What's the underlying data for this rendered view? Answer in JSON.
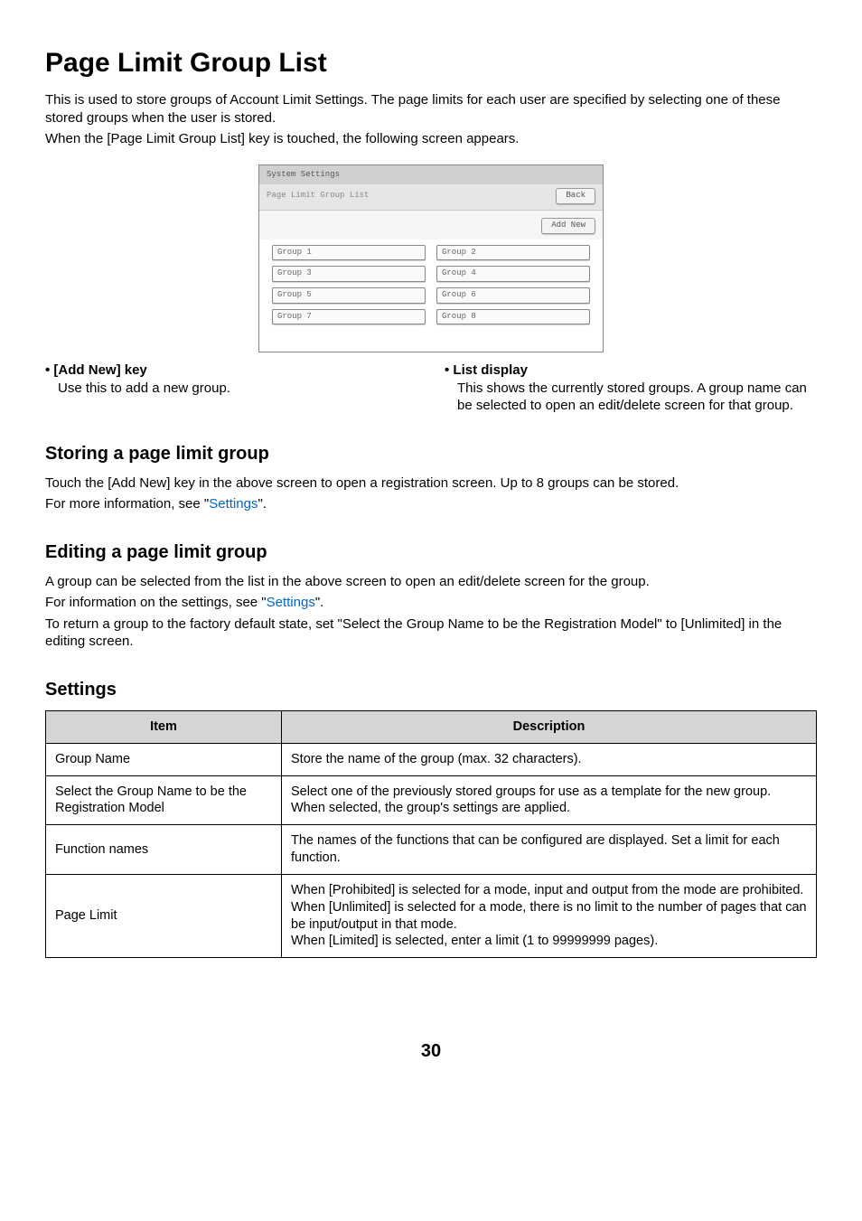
{
  "title": "Page Limit Group List",
  "intro_p1": "This is used to store groups of Account Limit Settings. The page limits for each user are specified by selecting one of these stored groups when the user is stored.",
  "intro_p2": "When the [Page Limit Group List] key is touched, the following screen appears.",
  "screenshot": {
    "titlebar": "System Settings",
    "header_label": "Page Limit Group List",
    "back_label": "Back",
    "add_new_label": "Add New",
    "groups": [
      "Group 1",
      "Group 2",
      "Group 3",
      "Group 4",
      "Group 5",
      "Group 6",
      "Group 7",
      "Group 8"
    ]
  },
  "bullets": {
    "left": {
      "title": "[Add New] key",
      "body": "Use this to add a new group."
    },
    "right": {
      "title": "List display",
      "body": "This shows the currently stored groups. A group name can be selected to open an edit/delete screen for that group."
    }
  },
  "storing": {
    "heading": "Storing a page limit group",
    "line1": "Touch the [Add New] key in the above screen to open a registration screen. Up to 8 groups can be stored.",
    "line2a": "For more information, see \"",
    "line2b": "Settings",
    "line2c": "\"."
  },
  "editing": {
    "heading": "Editing a page limit group",
    "line1": "A group can be selected from the list in the above screen to open an edit/delete screen for the group.",
    "line2a": "For information on the settings, see \"",
    "line2b": "Settings",
    "line2c": "\".",
    "line3": "To return a group to the factory default state, set \"Select the Group Name to be the Registration Model\" to [Unlimited] in the editing screen."
  },
  "settings": {
    "heading": "Settings",
    "headers": {
      "item": "Item",
      "description": "Description"
    },
    "rows": [
      {
        "item": "Group Name",
        "desc": "Store the name of the group (max. 32 characters)."
      },
      {
        "item": "Select the Group Name to be the Registration Model",
        "desc": "Select one of the previously stored groups for use as a template for the new group. When selected, the group's settings are applied."
      },
      {
        "item": "Function names",
        "desc": "The names of the functions that can be configured are displayed. Set a limit for each function."
      },
      {
        "item": "Page Limit",
        "desc": "When [Prohibited] is selected for a mode, input and output from the mode are prohibited.\nWhen [Unlimited] is selected for a mode, there is no limit to the number of pages that can be input/output in that mode.\nWhen [Limited] is selected, enter a limit (1 to 99999999 pages)."
      }
    ]
  },
  "page_number": "30"
}
